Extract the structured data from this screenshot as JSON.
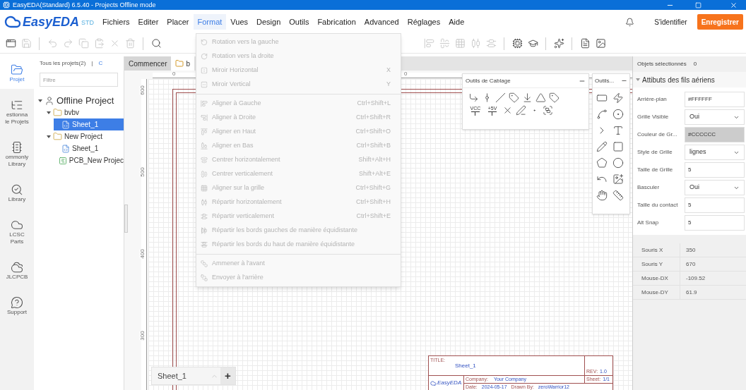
{
  "window": {
    "title": "EasyEDA(Standard) 6.5.40 - Projects Offline mode"
  },
  "menu_bar": {
    "logo": "EasyEDA",
    "edition": "STD",
    "items": [
      {
        "label": "Fichiers",
        "selected": false
      },
      {
        "label": "Editer",
        "selected": false
      },
      {
        "label": "Placer",
        "selected": false
      },
      {
        "label": "Format",
        "selected": true
      },
      {
        "label": "Vues",
        "selected": false
      },
      {
        "label": "Design",
        "selected": false
      },
      {
        "label": "Outils",
        "selected": false
      },
      {
        "label": "Fabrication",
        "selected": false
      },
      {
        "label": "Advanced",
        "selected": false
      },
      {
        "label": "Réglages",
        "selected": false
      },
      {
        "label": "Aide",
        "selected": false
      }
    ],
    "sign_in": "S'identifier",
    "register": "Enregistrer"
  },
  "toolbar_left": [
    {
      "kind": "window",
      "disabled": false
    },
    {
      "kind": "save",
      "disabled": true
    },
    {
      "kind": "sep"
    },
    {
      "kind": "undo",
      "disabled": true
    },
    {
      "kind": "redo",
      "disabled": true
    },
    {
      "kind": "copy",
      "disabled": true
    },
    {
      "kind": "paste",
      "disabled": true
    },
    {
      "kind": "cut",
      "disabled": true
    },
    {
      "kind": "delete",
      "disabled": true
    },
    {
      "kind": "sep"
    },
    {
      "kind": "search",
      "disabled": false
    }
  ],
  "toolbar_right": [
    {
      "kind": "align-left",
      "disabled": true
    },
    {
      "kind": "align-center",
      "disabled": true
    },
    {
      "kind": "grid",
      "disabled": true
    },
    {
      "kind": "distribute",
      "disabled": true
    },
    {
      "kind": "distribute-v",
      "disabled": true
    },
    {
      "kind": "sep"
    },
    {
      "kind": "chip",
      "disabled": false
    },
    {
      "kind": "hat",
      "disabled": false
    },
    {
      "kind": "sep"
    },
    {
      "kind": "spark",
      "disabled": false
    },
    {
      "kind": "sep"
    },
    {
      "kind": "doc",
      "disabled": false
    },
    {
      "kind": "image",
      "disabled": false
    }
  ],
  "left_rail": [
    {
      "kind": "project",
      "lines": [
        "Projet"
      ],
      "selected": true
    },
    {
      "kind": "list",
      "lines": [
        "estionna",
        "le Projets"
      ],
      "selected": false
    },
    {
      "kind": "chip",
      "lines": [
        "ommonly",
        "Library"
      ],
      "selected": false
    },
    {
      "kind": "library",
      "lines": [
        "Library"
      ],
      "selected": false
    },
    {
      "kind": "lcsc",
      "lines": [
        "LCSC",
        "Parts"
      ],
      "selected": false
    },
    {
      "kind": "jlc",
      "lines": [
        "JLCPCB"
      ],
      "selected": false
    },
    {
      "kind": "help",
      "lines": [
        "Support"
      ],
      "selected": false
    }
  ],
  "project_panel": {
    "scope": "Tous les projets(2)",
    "separator": "|",
    "scope_next": "C",
    "filter": {
      "placeholder": "Filtre"
    },
    "tree": [
      {
        "label": "Offline Project",
        "kind": "user",
        "expanded": true,
        "selected": false,
        "children": [
          {
            "label": "bvbv",
            "kind": "folder",
            "expanded": true,
            "selected": false,
            "children": [
              {
                "label": "Sheet_1",
                "kind": "schematic",
                "selected": true
              }
            ]
          },
          {
            "label": "New Project",
            "kind": "folder",
            "expanded": true,
            "selected": false,
            "children": [
              {
                "label": "Sheet_1",
                "kind": "schematic",
                "selected": false
              },
              {
                "label": "PCB_New Projec",
                "kind": "pcb",
                "selected": false
              }
            ]
          }
        ]
      }
    ]
  },
  "editor_tabs": [
    {
      "label": "Commencer",
      "kind": "start",
      "selected": false
    },
    {
      "label": "b",
      "kind": "folder",
      "selected": true
    }
  ],
  "ruler": {
    "top_labels": [
      "0",
      "0"
    ],
    "left_labels": [
      "600",
      "500",
      "400",
      "300"
    ]
  },
  "format_menu": {
    "sections": [
      [
        {
          "label": "Rotation vers la gauche",
          "kind": "rotate-left",
          "disabled": true
        },
        {
          "label": "Rotation vers la droite",
          "kind": "rotate-right",
          "disabled": true
        },
        {
          "label": "Miroir Horizontal",
          "shortcut": "X",
          "kind": "flip-h",
          "disabled": true
        },
        {
          "label": "Miroir Vertical",
          "shortcut": "Y",
          "kind": "flip-v",
          "disabled": true
        }
      ],
      [
        {
          "label": "Aligner à Gauche",
          "shortcut": "Ctrl+Shift+L",
          "kind": "align-left",
          "disabled": true
        },
        {
          "label": "Aligner à Droite",
          "shortcut": "Ctrl+Shift+R",
          "kind": "align-right",
          "disabled": true
        },
        {
          "label": "Aligner en Haut",
          "shortcut": "Ctrl+Shift+O",
          "kind": "align-top",
          "disabled": true
        },
        {
          "label": "Aligner en Bas",
          "shortcut": "Ctrl+Shift+B",
          "kind": "align-bottom",
          "disabled": true
        },
        {
          "label": "Centrer horizontalement",
          "shortcut": "Shift+Alt+H",
          "kind": "center-h",
          "disabled": true
        },
        {
          "label": "Centrer verticalement",
          "shortcut": "Shift+Alt+E",
          "kind": "center-v",
          "disabled": true
        },
        {
          "label": "Aligner sur la grille",
          "shortcut": "Ctrl+Shift+G",
          "kind": "grid",
          "disabled": true
        },
        {
          "label": "Répartir horizontalement",
          "shortcut": "Ctrl+Shift+H",
          "kind": "dist-h",
          "disabled": true
        },
        {
          "label": "Répartir verticalement",
          "shortcut": "Ctrl+Shift+E",
          "kind": "dist-v",
          "disabled": true
        },
        {
          "label": "Répartir les bords gauches de manière équidistante",
          "kind": "dist-left",
          "disabled": true
        },
        {
          "label": "Répartir les bords du haut de manière équidistante",
          "kind": "dist-top",
          "disabled": true
        }
      ],
      [
        {
          "label": "Ammener à l'avant",
          "kind": "front",
          "disabled": true
        },
        {
          "label": "Envoyer à l'arrière",
          "kind": "back",
          "disabled": true
        }
      ]
    ]
  },
  "wiring_tools": {
    "title": "Outils de Cablage",
    "power_labels": [
      "VCC",
      "+5V"
    ]
  },
  "drawing_tools": {
    "title": "Outils..."
  },
  "sheet_tabs": {
    "items": [
      {
        "label": "Sheet_1",
        "selected": true
      }
    ],
    "add": "+"
  },
  "title_block": {
    "title_label": "TITLE:",
    "title": "Sheet_1",
    "rev_label": "REV:",
    "rev": "1.0",
    "logo": "EasyEDA",
    "company_label": "Company:",
    "company": "Your Company",
    "sheet_label": "Sheet:",
    "sheet": "1/1",
    "date_label": "Date:",
    "date": "2024-05-17",
    "drawn_label": "Drawn By:",
    "drawn": "zeroWarrior12"
  },
  "properties": {
    "selected_label": "Objets sélectionnés",
    "selected_count": "0",
    "section": "Attibuts des fils aériens",
    "expanded": true,
    "rows": [
      {
        "label": "Arrière-plan",
        "value": "#FFFFFF",
        "kind": "color"
      },
      {
        "label": "Grille Visible",
        "value": "Oui",
        "kind": "select"
      },
      {
        "label": "Couleur de Gr...",
        "value": "#CCCCCC",
        "kind": "color"
      },
      {
        "label": "Style de Grille",
        "value": "lignes",
        "kind": "select"
      },
      {
        "label": "Taille de Grille",
        "value": "5",
        "kind": "text"
      },
      {
        "label": "Basculer",
        "value": "Oui",
        "kind": "select"
      },
      {
        "label": "Taille du contact",
        "value": "5",
        "kind": "text"
      },
      {
        "label": "Alt Snap",
        "value": "5",
        "kind": "text"
      }
    ],
    "mouse": [
      {
        "label": "Souris X",
        "value": "350"
      },
      {
        "label": "Souris Y",
        "value": "670"
      },
      {
        "label": "Mouse-DX",
        "value": "-109.52"
      },
      {
        "label": "Mouse-DY",
        "value": "61.9"
      }
    ]
  }
}
